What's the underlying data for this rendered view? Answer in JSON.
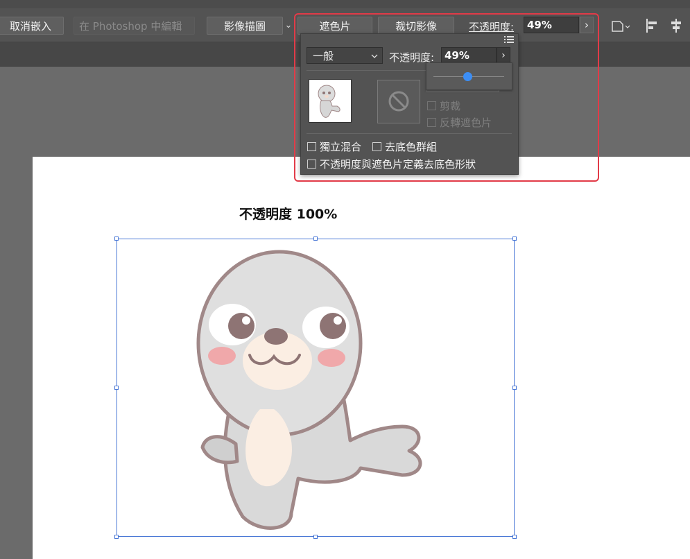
{
  "toolbar": {
    "unembed_label": "取消嵌入",
    "edit_photoshop_label": "在 Photoshop 中編輯",
    "image_trace_label": "影像描圖",
    "image_trace_chevron": "⌄",
    "mask_label": "遮色片",
    "crop_label": "裁切影像",
    "opacity_label": "不透明度:",
    "opacity_value": "49%",
    "opacity_arrow": "›"
  },
  "panel": {
    "blend_mode": "一般",
    "opacity_label": "不透明度:",
    "opacity_value": "49%",
    "opacity_arrow": "›",
    "clip_label": "剪裁",
    "invert_mask_label": "反轉遮色片",
    "isolate_blend_label": "獨立混合",
    "knockout_group_label": "去底色群組",
    "opacity_mask_knockout_label": "不透明度與遮色片定義去底色形狀"
  },
  "slider": {
    "opacity_percent": 49
  },
  "canvas": {
    "label": "不透明度  100%"
  },
  "icons": {
    "panel_menu": "menu-icon",
    "no_mask": "no-symbol-icon",
    "transform": "transform-icon",
    "align_left": "align-left-icon",
    "align_center": "align-center-icon"
  },
  "colors": {
    "highlight": "#e23b48",
    "selection": "#4a78d6",
    "slider_knob": "#3c8ef5"
  }
}
